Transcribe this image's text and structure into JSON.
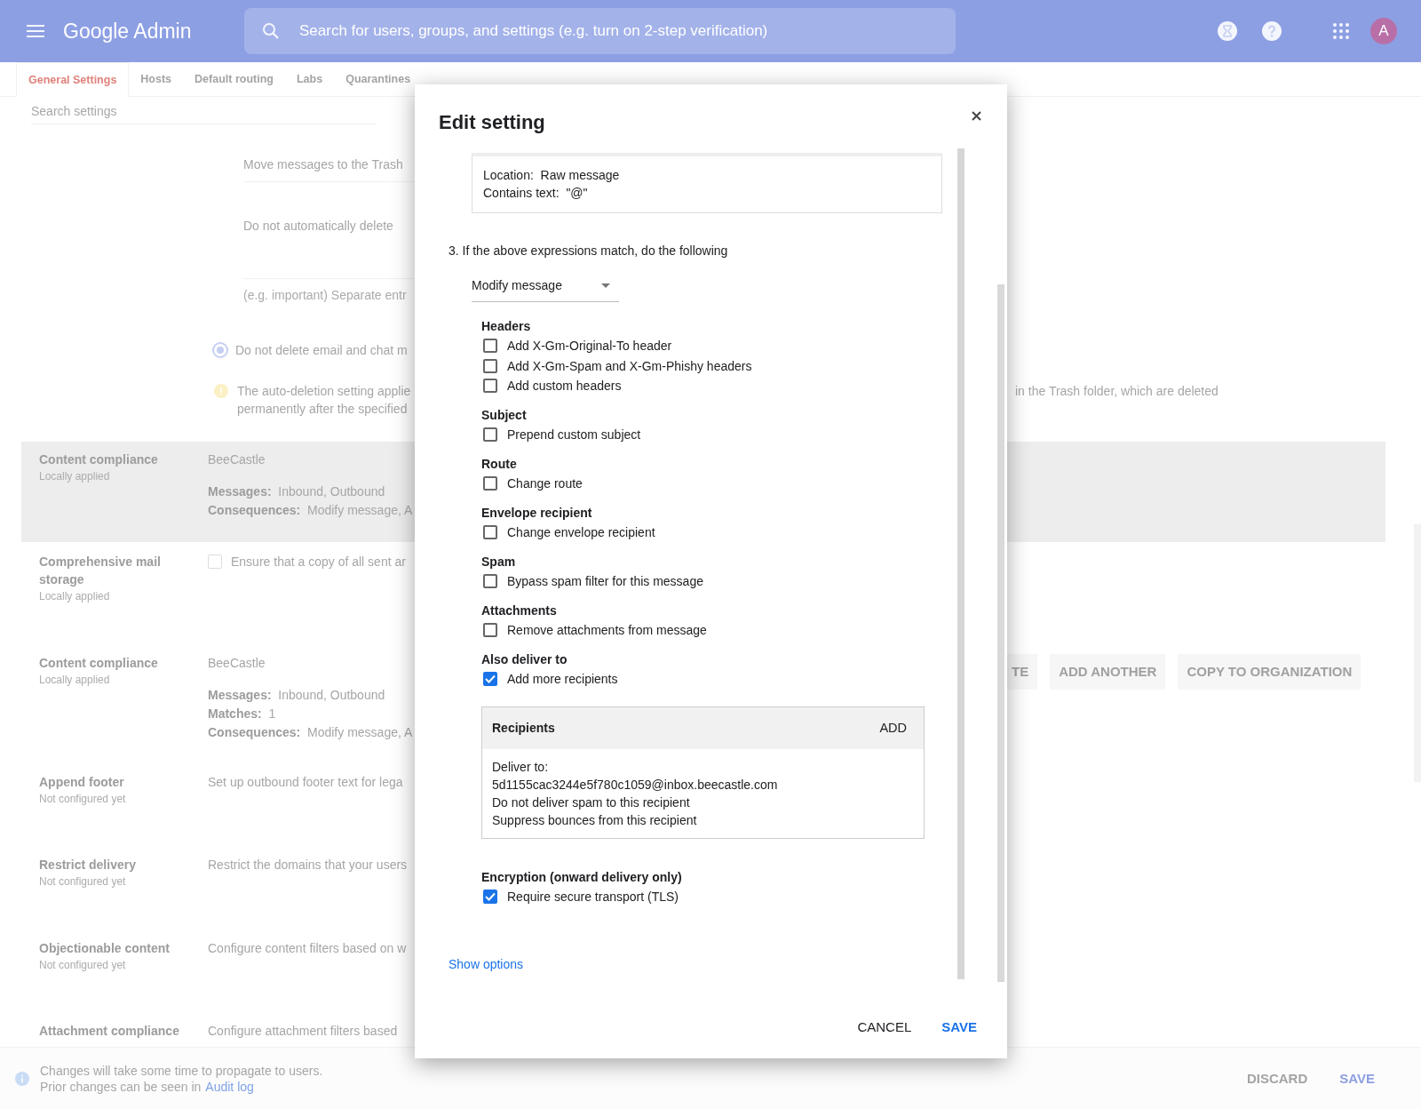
{
  "top_bar": {
    "product": "Google Admin",
    "search": {
      "placeholder": "Search for users, groups, and settings (e.g. turn on 2-step verification)"
    },
    "avatar": "A"
  },
  "tabs": [
    {
      "label": "General Settings",
      "selected": true
    },
    {
      "label": "Hosts",
      "selected": false
    },
    {
      "label": "Default routing",
      "selected": false
    },
    {
      "label": "Labs",
      "selected": false
    },
    {
      "label": "Quarantines",
      "selected": false
    }
  ],
  "settings_search": {
    "placeholder": "Search settings"
  },
  "auto_deletion": {
    "move_field": "Move messages to the Trash",
    "delete_field": "Do not automatically delete",
    "labels_field": {
      "placeholder": "(e.g. important) Separate entr"
    },
    "option": {
      "label": "Do not delete email and chat m",
      "selected": true
    },
    "note": [
      "The auto-deletion setting applie",
      "permanently after the specified"
    ],
    "note_continued": "in the Trash folder, which are deleted"
  },
  "setting_rows": [
    {
      "title": "Content compliance",
      "status": "Locally applied",
      "highlighted": true,
      "kind": "rule",
      "name": "BeeCastle",
      "details": [
        {
          "label": "Messages:",
          "value": "Inbound, Outbound"
        },
        {
          "label": "Consequences:",
          "value": "Modify message, A"
        }
      ]
    },
    {
      "title": "Comprehensive mail storage",
      "status": "Locally applied",
      "highlighted": false,
      "kind": "checkbox",
      "label": "Ensure that a copy of all sent ar",
      "checked": false
    },
    {
      "title": "Content compliance",
      "status": "Locally applied",
      "highlighted": false,
      "kind": "rule",
      "name": "BeeCastle",
      "details": [
        {
          "label": "Messages:",
          "value": "Inbound, Outbound"
        },
        {
          "label": "Matches:",
          "value": "1"
        },
        {
          "label": "Consequences:",
          "value": "Modify message, A"
        }
      ],
      "actions": [
        "TE",
        "ADD ANOTHER",
        "COPY TO ORGANIZATION"
      ]
    },
    {
      "title": "Append footer",
      "status": "Not configured yet",
      "highlighted": false,
      "kind": "text",
      "description": "Set up outbound footer text for lega"
    },
    {
      "title": "Restrict delivery",
      "status": "Not configured yet",
      "highlighted": false,
      "kind": "text",
      "description": "Restrict the domains that your users"
    },
    {
      "title": "Objectionable content",
      "status": "Not configured yet",
      "highlighted": false,
      "kind": "text",
      "description": "Configure content filters based on w"
    },
    {
      "title": "Attachment compliance",
      "highlighted": false,
      "kind": "text",
      "description": "Configure attachment filters based"
    }
  ],
  "footer": {
    "message": "Changes will take some time to propagate to users.",
    "prior": "Prior changes can be seen in",
    "link": "Audit log",
    "buttons": [
      {
        "label": "DISCARD",
        "kind": "secondary"
      },
      {
        "label": "SAVE",
        "kind": "primary"
      }
    ]
  },
  "dialog": {
    "title": "Edit setting",
    "expression_lines": [
      "Location:  Raw message",
      "Contains text:  \"@\""
    ],
    "step": "3. If the above expressions match, do the following",
    "action": "Modify message",
    "groups": [
      {
        "heading": "Headers",
        "options": [
          {
            "label": "Add X-Gm-Original-To header",
            "checked": false
          },
          {
            "label": "Add X-Gm-Spam and X-Gm-Phishy headers",
            "checked": false
          },
          {
            "label": "Add custom headers",
            "checked": false
          }
        ]
      },
      {
        "heading": "Subject",
        "options": [
          {
            "label": "Prepend custom subject",
            "checked": false
          }
        ]
      },
      {
        "heading": "Route",
        "options": [
          {
            "label": "Change route",
            "checked": false
          }
        ]
      },
      {
        "heading": "Envelope recipient",
        "options": [
          {
            "label": "Change envelope recipient",
            "checked": false
          }
        ]
      },
      {
        "heading": "Spam",
        "options": [
          {
            "label": "Bypass spam filter for this message",
            "checked": false
          }
        ]
      },
      {
        "heading": "Attachments",
        "options": [
          {
            "label": "Remove attachments from message",
            "checked": false
          }
        ]
      },
      {
        "heading": "Also deliver to",
        "options": [
          {
            "label": "Add more recipients",
            "checked": true
          }
        ],
        "recipients": {
          "title": "Recipients",
          "add": "ADD",
          "lines": [
            "Deliver to:",
            "5d1155cac3244e5f780c1059@inbox.beecastle.com",
            "Do not deliver spam to this recipient",
            "Suppress bounces from this recipient"
          ]
        }
      },
      {
        "heading": "Encryption (onward delivery only)",
        "options": [
          {
            "label": "Require secure transport (TLS)",
            "checked": true
          }
        ]
      }
    ],
    "show_options": "Show options",
    "buttons": [
      {
        "label": "CANCEL",
        "kind": "secondary"
      },
      {
        "label": "SAVE",
        "kind": "primary"
      }
    ]
  }
}
